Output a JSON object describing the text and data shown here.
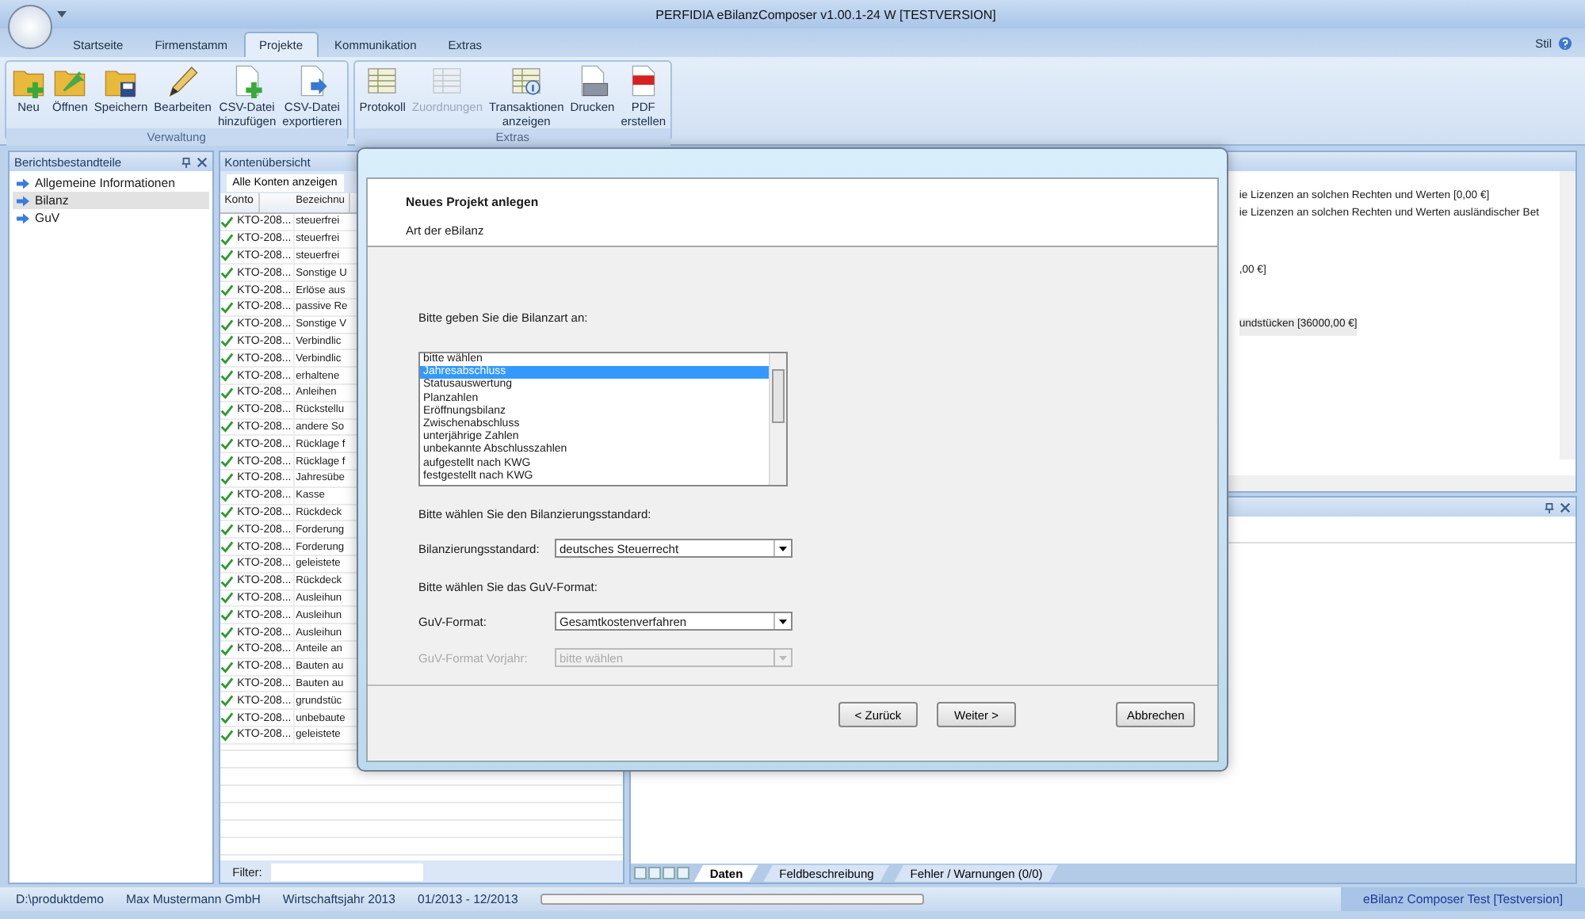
{
  "window": {
    "title": "PERFIDIA eBilanzComposer v1.00.1-24 W [TESTVERSION]"
  },
  "ribbon": {
    "tabs": [
      {
        "label": "Startseite",
        "selected": false
      },
      {
        "label": "Firmenstamm",
        "selected": false
      },
      {
        "label": "Projekte",
        "selected": true
      },
      {
        "label": "Kommunikation",
        "selected": false
      },
      {
        "label": "Extras",
        "selected": false
      }
    ],
    "style_menu": "Stil",
    "groups": [
      {
        "title": "Verwaltung",
        "buttons": [
          {
            "label": "Neu",
            "kind": "new",
            "disabled": false
          },
          {
            "label": "Öffnen",
            "kind": "open",
            "disabled": false
          },
          {
            "label": "Speichern",
            "kind": "save",
            "disabled": false
          },
          {
            "label": "Bearbeiten",
            "kind": "edit",
            "disabled": false
          },
          {
            "label": "CSV-Datei\nhinzufügen",
            "kind": "add-file",
            "disabled": false
          },
          {
            "label": "CSV-Datei\nexportieren",
            "kind": "export",
            "disabled": false
          }
        ]
      },
      {
        "title": "Extras",
        "buttons": [
          {
            "label": "Protokoll",
            "kind": "table",
            "disabled": false
          },
          {
            "label": "Zuordnungen",
            "kind": "table",
            "disabled": true
          },
          {
            "label": "Transaktionen\nanzeigen",
            "kind": "info-table",
            "disabled": false
          },
          {
            "label": "Drucken",
            "kind": "print",
            "disabled": false
          },
          {
            "label": "PDF\nerstellen",
            "kind": "pdf",
            "disabled": false
          }
        ]
      }
    ]
  },
  "report_parts": {
    "title": "Berichtsbestandteile",
    "items": [
      {
        "label": "Allgemeine Informationen",
        "selected": false
      },
      {
        "label": "Bilanz",
        "selected": true
      },
      {
        "label": "GuV",
        "selected": false
      }
    ]
  },
  "accounts": {
    "title": "Kontenübersicht",
    "show_all": "Alle Konten anzeigen",
    "columns": [
      "Konto",
      "Bezeichnu"
    ],
    "rows": [
      {
        "konto": "KTO-208...",
        "name": "steuerfrei"
      },
      {
        "konto": "KTO-208...",
        "name": "steuerfrei"
      },
      {
        "konto": "KTO-208...",
        "name": "steuerfrei"
      },
      {
        "konto": "KTO-208...",
        "name": "Sonstige U"
      },
      {
        "konto": "KTO-208...",
        "name": "Erlöse aus"
      },
      {
        "konto": "KTO-208...",
        "name": "passive Re"
      },
      {
        "konto": "KTO-208...",
        "name": "Sonstige V"
      },
      {
        "konto": "KTO-208...",
        "name": "Verbindlic"
      },
      {
        "konto": "KTO-208...",
        "name": "Verbindlic"
      },
      {
        "konto": "KTO-208...",
        "name": "erhaltene"
      },
      {
        "konto": "KTO-208...",
        "name": "Anleihen"
      },
      {
        "konto": "KTO-208...",
        "name": "Rückstellu"
      },
      {
        "konto": "KTO-208...",
        "name": "andere So"
      },
      {
        "konto": "KTO-208...",
        "name": "Rücklage f"
      },
      {
        "konto": "KTO-208...",
        "name": "Rücklage f"
      },
      {
        "konto": "KTO-208...",
        "name": "Jahresübe"
      },
      {
        "konto": "KTO-208...",
        "name": "Kasse"
      },
      {
        "konto": "KTO-208...",
        "name": "Rückdeck"
      },
      {
        "konto": "KTO-208...",
        "name": "Forderung"
      },
      {
        "konto": "KTO-208...",
        "name": "Forderung"
      },
      {
        "konto": "KTO-208...",
        "name": "geleistete"
      },
      {
        "konto": "KTO-208...",
        "name": "Rückdeck"
      },
      {
        "konto": "KTO-208...",
        "name": "Ausleihun"
      },
      {
        "konto": "KTO-208...",
        "name": "Ausleihun"
      },
      {
        "konto": "KTO-208...",
        "name": "Ausleihun"
      },
      {
        "konto": "KTO-208...",
        "name": "Anteile an"
      },
      {
        "konto": "KTO-208...",
        "name": "Bauten au"
      },
      {
        "konto": "KTO-208...",
        "name": "Bauten au"
      },
      {
        "konto": "KTO-208...",
        "name": "grundstüc"
      },
      {
        "konto": "KTO-208...",
        "name": "unbebaute"
      },
      {
        "konto": "KTO-208...",
        "name": "geleistete"
      }
    ],
    "filter_label": "Filter:"
  },
  "details": {
    "lines": [
      "ie Lizenzen an solchen Rechten und Werten [0,00 €]",
      "ie Lizenzen an solchen Rechten und Werten ausländischer Bet",
      ",00 €]",
      "undstücken [36000,00 €]"
    ]
  },
  "bottom_tabs": [
    {
      "label": "Daten",
      "selected": true
    },
    {
      "label": "Feldbeschreibung",
      "selected": false
    },
    {
      "label": "Fehler / Warnungen (0/0)",
      "selected": false
    }
  ],
  "status_bar": {
    "items": [
      "D:\\produktdemo",
      "Max Mustermann GmbH",
      "Wirtschaftsjahr 2013",
      "01/2013 - 12/2013"
    ],
    "right": "eBilanz Composer Test [Testversion]",
    "progress": {
      "level": 0
    }
  },
  "dialog": {
    "title": "Neues Projekt anlegen",
    "subtitle": "Art der eBilanz",
    "prompt": "Bitte geben Sie die Bilanzart an:",
    "balance_types": [
      {
        "label": "bitte wählen",
        "selected": false
      },
      {
        "label": "Jahresabschluss",
        "selected": true
      },
      {
        "label": "Statusauswertung",
        "selected": false
      },
      {
        "label": "Planzahlen",
        "selected": false
      },
      {
        "label": "Eröffnungsbilanz",
        "selected": false
      },
      {
        "label": "Zwischenabschluss",
        "selected": false
      },
      {
        "label": "unterjährige Zahlen",
        "selected": false
      },
      {
        "label": "unbekannte Abschlusszahlen",
        "selected": false
      },
      {
        "label": "aufgestellt nach KWG",
        "selected": false
      },
      {
        "label": "festgestellt nach KWG",
        "selected": false
      }
    ],
    "sections": [
      {
        "prompt": "Bitte wählen Sie den Bilanzierungsstandard:",
        "fields": [
          {
            "label": "Bilanzierungsstandard:",
            "value": "deutsches Steuerrecht",
            "disabled": false
          }
        ]
      },
      {
        "prompt": "Bitte wählen Sie das GuV-Format:",
        "fields": [
          {
            "label": "GuV-Format:",
            "value": "Gesamtkostenverfahren",
            "disabled": false
          },
          {
            "label": "GuV-Format Vorjahr:",
            "value": "bitte wählen",
            "disabled": true
          }
        ]
      }
    ],
    "buttons": [
      "< Zurück",
      "Weiter >",
      "Abbrechen"
    ]
  }
}
